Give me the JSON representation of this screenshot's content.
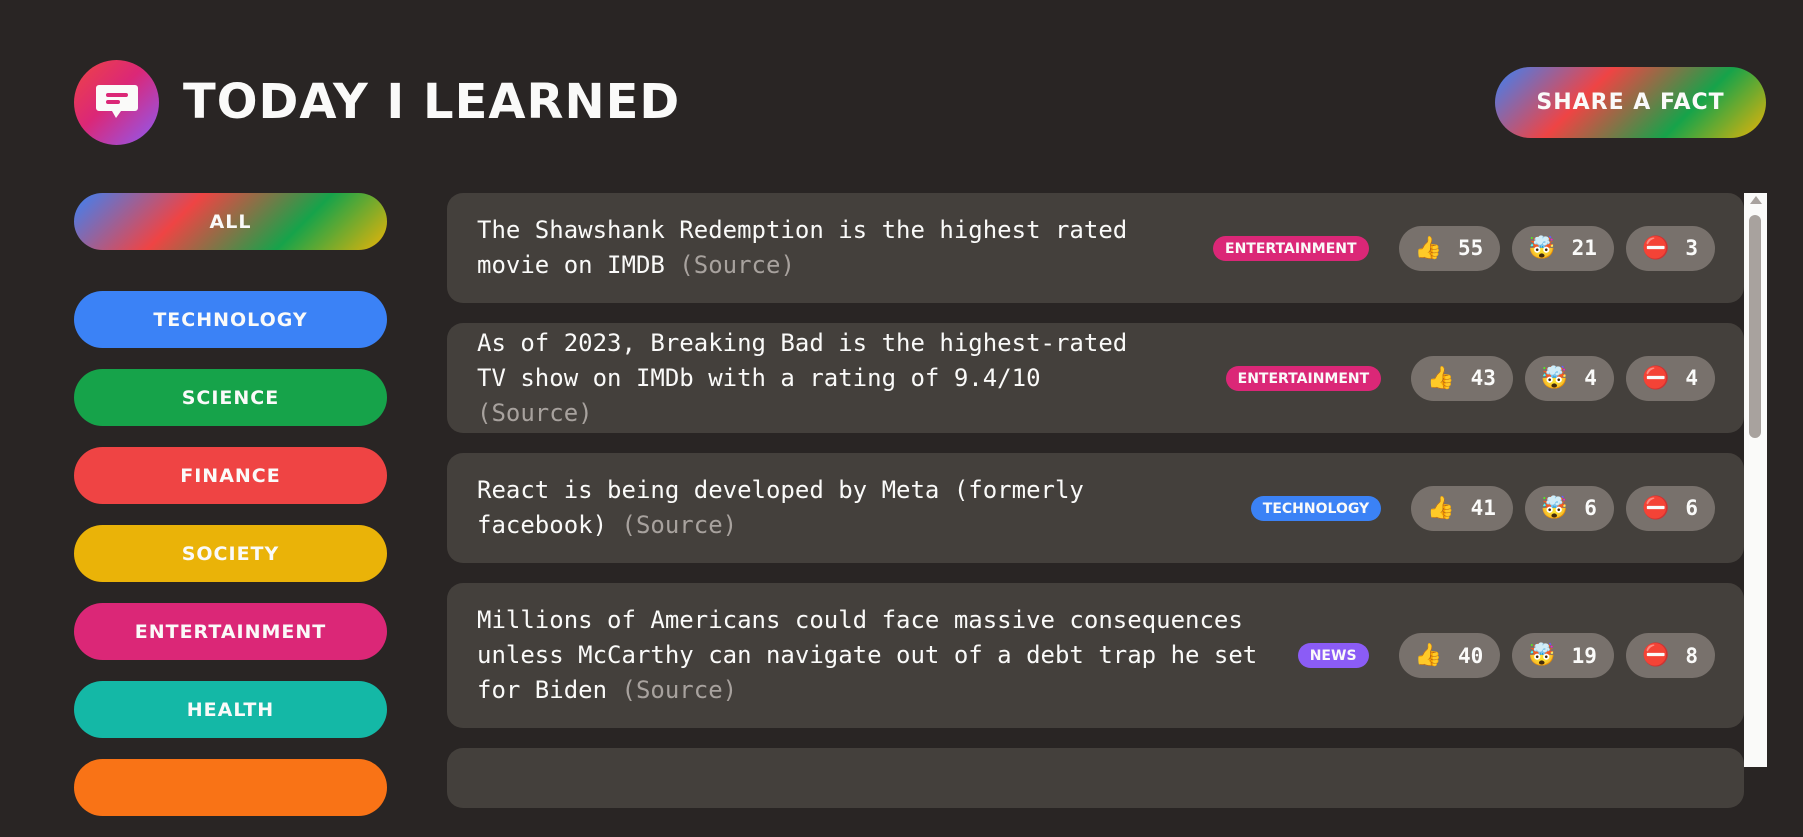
{
  "header": {
    "title": "Today I Learned",
    "share_button": "Share a fact"
  },
  "sidebar": {
    "items": [
      {
        "label": "All",
        "color": "gradient"
      },
      {
        "label": "Technology",
        "color": "#3b82f6"
      },
      {
        "label": "Science",
        "color": "#16a34a"
      },
      {
        "label": "Finance",
        "color": "#ef4444"
      },
      {
        "label": "Society",
        "color": "#eab308"
      },
      {
        "label": "Entertainment",
        "color": "#db2777"
      },
      {
        "label": "Health",
        "color": "#14b8a6"
      },
      {
        "label": "",
        "color": "#f97316"
      }
    ]
  },
  "facts": [
    {
      "text": "The Shawshank Redemption is the highest rated movie on IMDB",
      "source": "(Source)",
      "category": "Entertainment",
      "category_color": "#db2777",
      "votes_interesting": "55",
      "votes_mindblowing": "21",
      "votes_false": "3"
    },
    {
      "text": "As of 2023, Breaking Bad is the highest-rated TV show on IMDb with a rating of 9.4/10",
      "source": "(Source)",
      "category": "Entertainment",
      "category_color": "#db2777",
      "votes_interesting": "43",
      "votes_mindblowing": "4",
      "votes_false": "4"
    },
    {
      "text": "React is being developed by Meta (formerly facebook)",
      "source": "(Source)",
      "category": "Technology",
      "category_color": "#3b82f6",
      "votes_interesting": "41",
      "votes_mindblowing": "6",
      "votes_false": "6"
    },
    {
      "text": "Millions of Americans could face massive consequences unless McCarthy can navigate out of a debt trap he set for Biden",
      "source": "(Source)",
      "category": "News",
      "category_color": "#8b5cf6",
      "votes_interesting": "40",
      "votes_mindblowing": "19",
      "votes_false": "8"
    }
  ],
  "icons": {
    "interesting": "👍",
    "mindblowing": "🤯",
    "false": "⛔"
  },
  "colors": {
    "background": "#292524",
    "card": "#44403c",
    "vote_button": "#78716c"
  }
}
